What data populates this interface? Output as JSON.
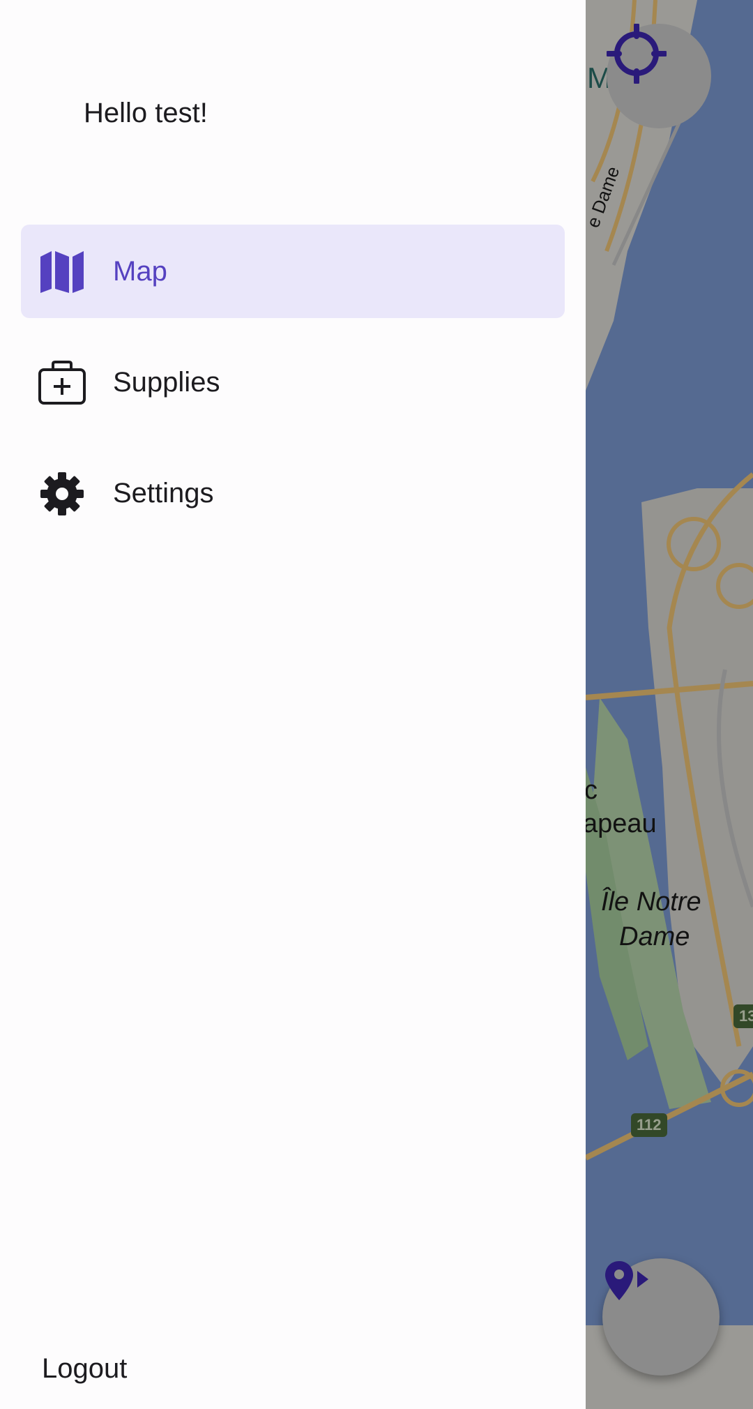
{
  "drawer": {
    "greeting": "Hello test!",
    "items": [
      {
        "label": "Map",
        "icon": "map-icon",
        "active": true
      },
      {
        "label": "Supplies",
        "icon": "medical-bag-icon",
        "active": false
      },
      {
        "label": "Settings",
        "icon": "gear-icon",
        "active": false
      }
    ],
    "logout_label": "Logout"
  },
  "map": {
    "labels": {
      "top_partial": "M",
      "notre_dame_street": "e Dame",
      "park_partial_1": "c",
      "park_partial_2": "apeau",
      "island_line1": "Île Notre",
      "island_line2": "Dame"
    },
    "route_shields": [
      "112",
      "13"
    ]
  },
  "colors": {
    "accent": "#5541c0",
    "active_background": "#eae7fa",
    "drawer_background": "#fdfcfd",
    "fab_icon": "#2a1a7a"
  },
  "fabs": {
    "locate_icon": "crosshair-icon",
    "route_icon": "location-arrow-icon"
  }
}
